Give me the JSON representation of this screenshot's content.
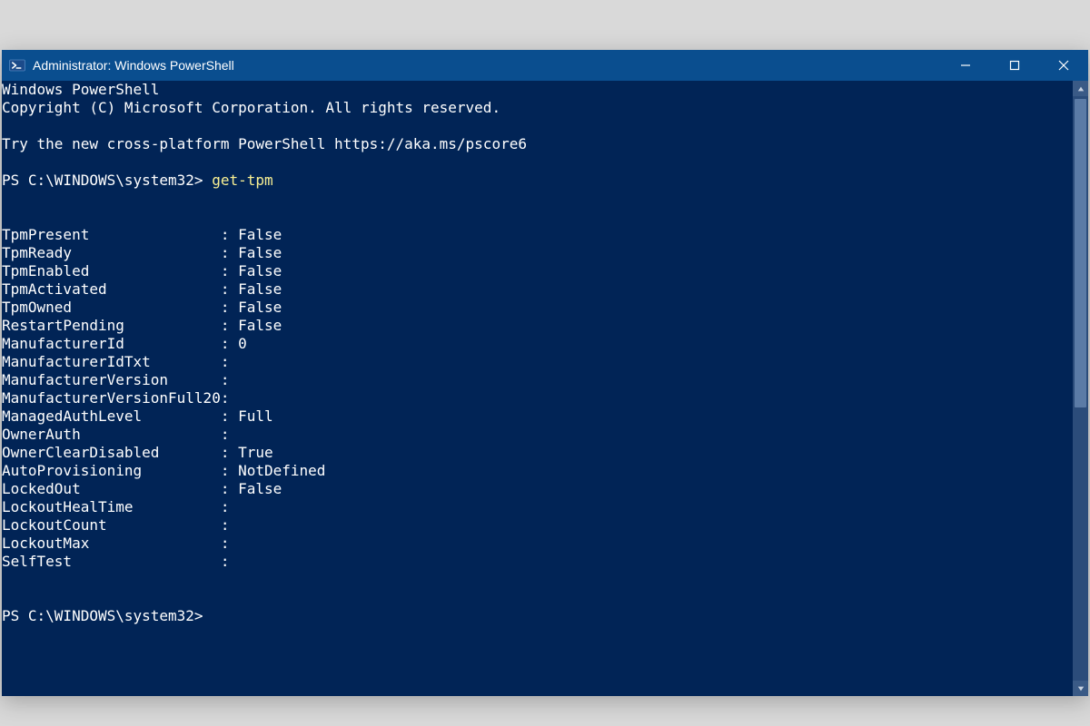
{
  "window": {
    "title": "Administrator: Windows PowerShell",
    "buttons": {
      "minimize": "minimize",
      "maximize": "maximize",
      "close": "close"
    }
  },
  "terminal": {
    "header_lines": [
      "Windows PowerShell",
      "Copyright (C) Microsoft Corporation. All rights reserved.",
      "",
      "Try the new cross-platform PowerShell https://aka.ms/pscore6",
      ""
    ],
    "prompt1": {
      "prefix": "PS C:\\WINDOWS\\system32> ",
      "command": "get-tpm"
    },
    "output_kv": [
      {
        "key": "TpmPresent",
        "value": "False"
      },
      {
        "key": "TpmReady",
        "value": "False"
      },
      {
        "key": "TpmEnabled",
        "value": "False"
      },
      {
        "key": "TpmActivated",
        "value": "False"
      },
      {
        "key": "TpmOwned",
        "value": "False"
      },
      {
        "key": "RestartPending",
        "value": "False"
      },
      {
        "key": "ManufacturerId",
        "value": "0"
      },
      {
        "key": "ManufacturerIdTxt",
        "value": ""
      },
      {
        "key": "ManufacturerVersion",
        "value": ""
      },
      {
        "key": "ManufacturerVersionFull20",
        "value": ""
      },
      {
        "key": "ManagedAuthLevel",
        "value": "Full"
      },
      {
        "key": "OwnerAuth",
        "value": ""
      },
      {
        "key": "OwnerClearDisabled",
        "value": "True"
      },
      {
        "key": "AutoProvisioning",
        "value": "NotDefined"
      },
      {
        "key": "LockedOut",
        "value": "False"
      },
      {
        "key": "LockoutHealTime",
        "value": ""
      },
      {
        "key": "LockoutCount",
        "value": ""
      },
      {
        "key": "LockoutMax",
        "value": ""
      },
      {
        "key": "SelfTest",
        "value": ""
      }
    ],
    "kv_key_width_chars": 25,
    "prompt2": {
      "prefix": "PS C:\\WINDOWS\\system32> ",
      "command": ""
    }
  }
}
